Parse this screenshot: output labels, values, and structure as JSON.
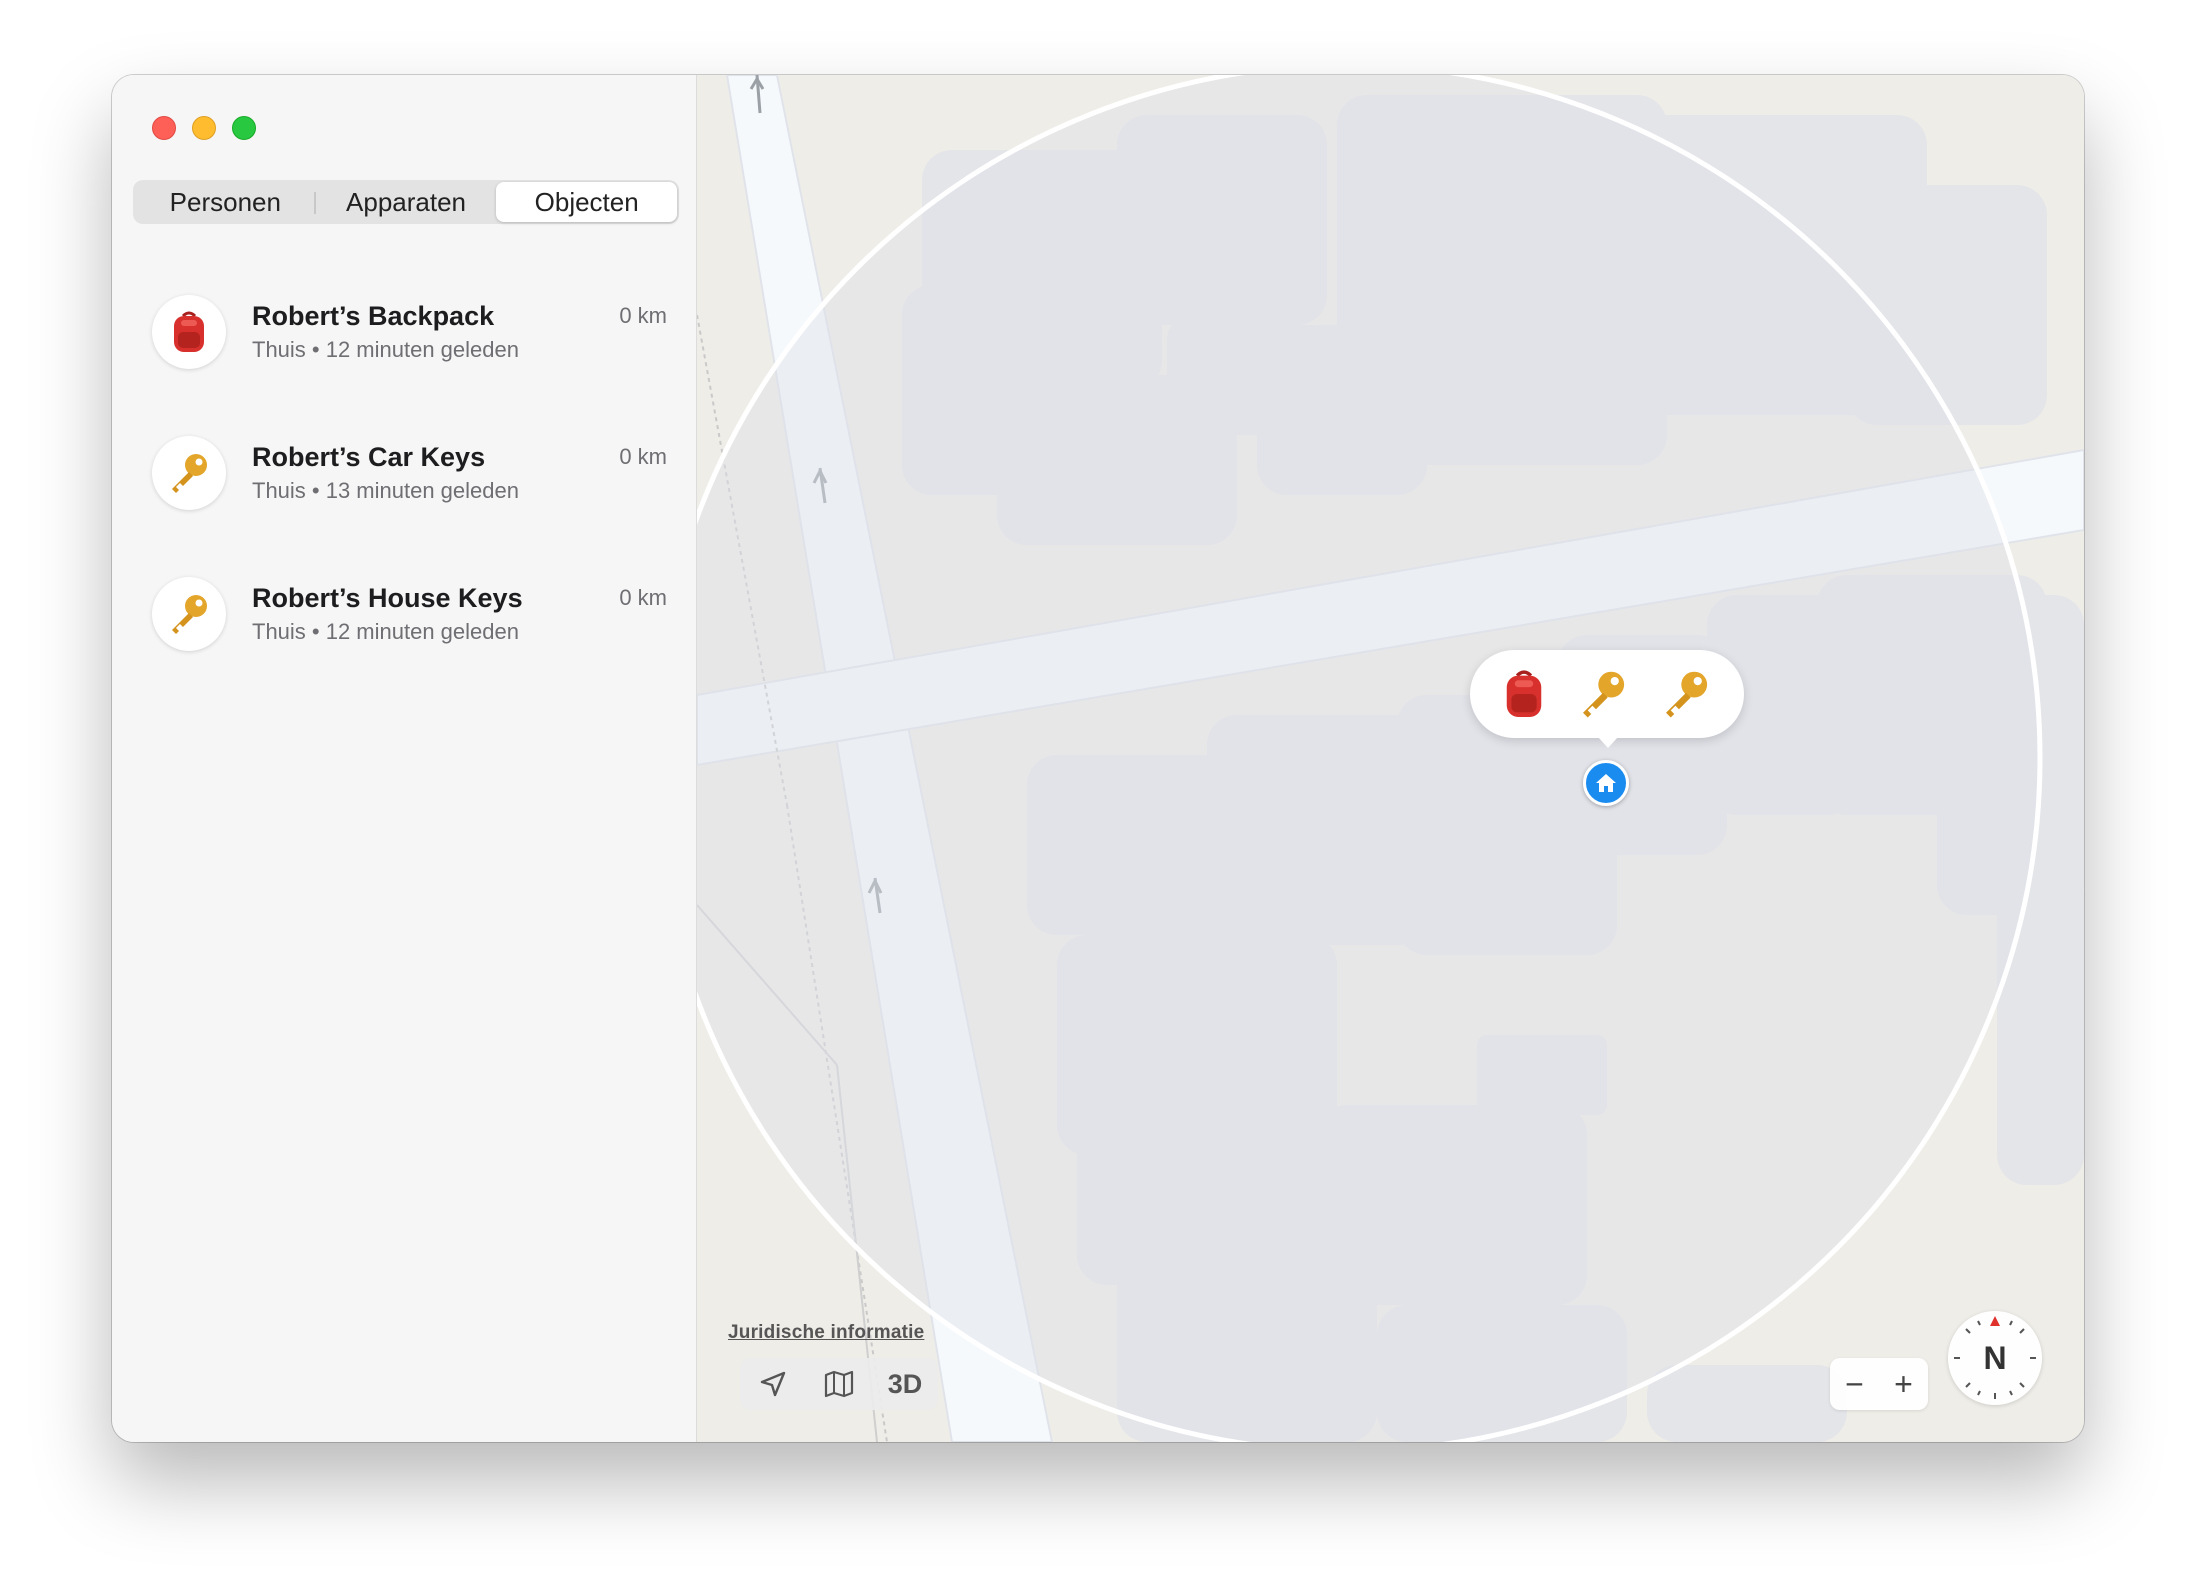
{
  "tabs": [
    {
      "label": "Personen",
      "active": false
    },
    {
      "label": "Apparaten",
      "active": false
    },
    {
      "label": "Objecten",
      "active": true
    }
  ],
  "items": [
    {
      "name": "Robert’s Backpack",
      "status": "Thuis • 12 minuten geleden",
      "distance": "0 km",
      "icon": "backpack-icon"
    },
    {
      "name": "Robert’s Car Keys",
      "status": "Thuis • 13 minuten geleden",
      "distance": "0 km",
      "icon": "key-icon"
    },
    {
      "name": "Robert’s House Keys",
      "status": "Thuis • 12 minuten geleden",
      "distance": "0 km",
      "icon": "key-icon"
    }
  ],
  "map": {
    "legal_label": "Juridische informatie",
    "view_3d_label": "3D",
    "zoom_out_label": "−",
    "zoom_in_label": "+",
    "compass_label": "N"
  },
  "colors": {
    "accent": "#1a8cf0",
    "backpack": "#d8312d",
    "key": "#e3a52a"
  }
}
